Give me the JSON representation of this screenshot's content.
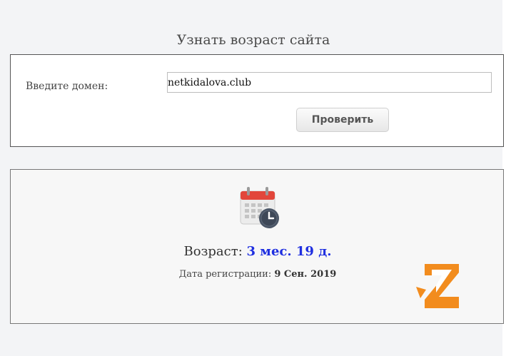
{
  "page": {
    "title": "Узнать возраст сайта"
  },
  "form": {
    "domain_label": "Введите домен:",
    "domain_value": "netkidalova.club",
    "check_button": "Проверить"
  },
  "result": {
    "age_label": "Возраст:",
    "age_value": "3 мес. 19 д.",
    "reg_label": "Дата регистрации:",
    "reg_value": "9 Сен. 2019"
  },
  "icons": {
    "calendar": "calendar-clock-icon",
    "logo": "z-logo-icon"
  },
  "colors": {
    "accent_age": "#1f2fe0",
    "logo_orange": "#f28c1e",
    "calendar_red": "#e2463b"
  }
}
